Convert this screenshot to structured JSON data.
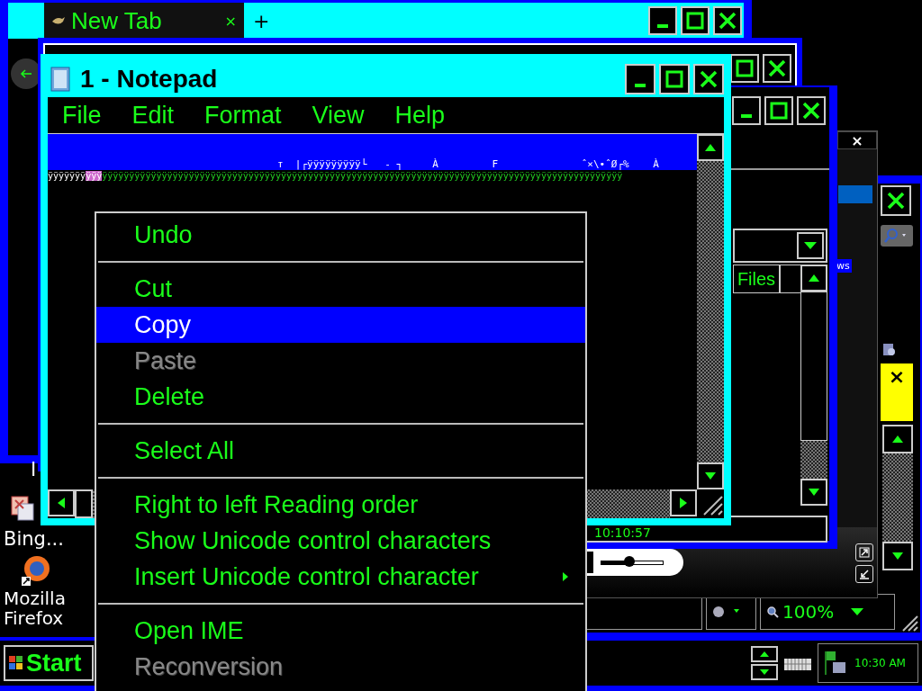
{
  "browser_window": {
    "tab": {
      "label": "New Tab",
      "selected": true
    },
    "tab_close": "×",
    "new_tab": "+"
  },
  "notepad": {
    "title": "1 - Notepad",
    "menu": [
      "File",
      "Edit",
      "Format",
      "View",
      "Help"
    ],
    "first_line": {
      "text": "т  |┌ÿÿÿÿÿÿÿÿÿ└   ‐ ┐     À         F              ˆ×\\•ˆØ┌%    À",
      "selected": true
    },
    "second_line": [
      {
        "kind": "bright",
        "text": "ÿÿÿÿÿÿÿ"
      },
      {
        "kind": "marked",
        "text": "ÿÿÿ"
      },
      {
        "kind": "normal",
        "text": "ÿÿÿÿÿÿÿÿÿÿÿÿÿÿÿÿÿÿÿÿÿÿÿÿÿÿÿÿÿÿÿÿÿÿÿÿÿÿÿÿÿÿÿÿÿÿÿÿÿÿÿÿÿÿÿÿÿÿÿÿÿÿÿÿÿÿÿÿÿÿÿÿÿÿÿÿÿÿÿÿÿÿÿÿÿÿÿÿÿÿÿÿÿÿÿÿ"
      }
    ]
  },
  "context_menu": [
    {
      "kind": "item",
      "label": "Undo",
      "selected": false,
      "disabled": false
    },
    {
      "kind": "separator"
    },
    {
      "kind": "item",
      "label": "Cut",
      "selected": false,
      "disabled": false
    },
    {
      "kind": "item",
      "label": "Copy",
      "selected": true,
      "disabled": false
    },
    {
      "kind": "item",
      "label": "Paste",
      "selected": false,
      "disabled": true
    },
    {
      "kind": "item",
      "label": "Delete",
      "selected": false,
      "disabled": false
    },
    {
      "kind": "separator"
    },
    {
      "kind": "item",
      "label": "Select All",
      "selected": false,
      "disabled": false
    },
    {
      "kind": "separator"
    },
    {
      "kind": "item",
      "label": "Right to left Reading order",
      "selected": false,
      "disabled": false
    },
    {
      "kind": "item",
      "label": "Show Unicode control characters",
      "selected": false,
      "disabled": false
    },
    {
      "kind": "submenu",
      "label": "Insert Unicode control character",
      "selected": false,
      "disabled": false
    },
    {
      "kind": "separator"
    },
    {
      "kind": "item",
      "label": "Open IME",
      "selected": false,
      "disabled": false
    },
    {
      "kind": "item",
      "label": "Reconversion",
      "selected": false,
      "disabled": true
    }
  ],
  "explorer_window": {
    "column_header": "Files"
  },
  "media_window": {
    "close": "×",
    "fragment": "ws",
    "time": "10:10:57",
    "volume": {
      "level": 0.45
    }
  },
  "browser_window_2": {
    "notification_close": "×",
    "zoom": "100%"
  },
  "desktop_icons": [
    {
      "label": "I"
    },
    {
      "label": "Bing..."
    },
    {
      "label": "Mozilla Firefox"
    }
  ],
  "taskbar": {
    "start": "Start",
    "clock": "10:30 AM"
  }
}
